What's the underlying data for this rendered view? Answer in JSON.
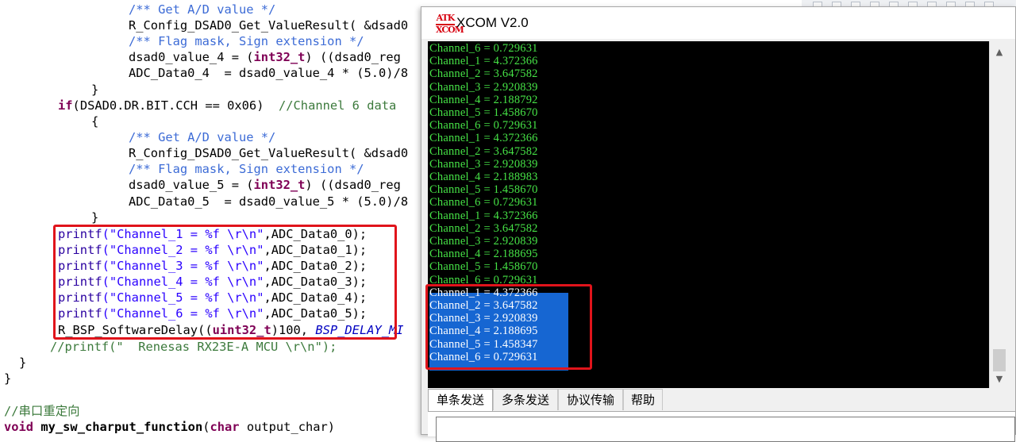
{
  "editor": {
    "lines": [
      [
        [
          "cm",
          "/** Get A/D value */"
        ]
      ],
      [
        [
          "id",
          "R_Config_DSAD0_Get_ValueResult( &dsad0"
        ]
      ],
      [
        [
          "cm",
          "/** Flag mask, Sign extension */"
        ]
      ],
      [
        [
          "id",
          "dsad0_value_4 = ("
        ],
        [
          "kw",
          "int32_t"
        ],
        [
          "id",
          ") ((dsad0_reg"
        ]
      ],
      [
        [
          "id",
          "ADC_Data0_4  = dsad0_value_4 * (5.0)/8"
        ]
      ],
      [
        [
          "id",
          "}"
        ]
      ],
      [
        [
          "kw",
          "if"
        ],
        [
          "id",
          "(DSAD0.DR.BIT.CCH == 0x06)  "
        ],
        [
          "gc",
          "//Channel 6 data"
        ]
      ],
      [
        [
          "id",
          "{"
        ]
      ],
      [
        [
          "cm",
          "/** Get A/D value */"
        ]
      ],
      [
        [
          "id",
          "R_Config_DSAD0_Get_ValueResult( &dsad0"
        ]
      ],
      [
        [
          "cm",
          "/** Flag mask, Sign extension */"
        ]
      ],
      [
        [
          "id",
          "dsad0_value_5 = ("
        ],
        [
          "kw",
          "int32_t"
        ],
        [
          "id",
          ") ((dsad0_reg"
        ]
      ],
      [
        [
          "id",
          "ADC_Data0_5  = dsad0_value_5 * (5.0)/8"
        ]
      ],
      [
        [
          "id",
          "}"
        ]
      ],
      [
        [
          "pp",
          "printf"
        ],
        [
          "st",
          "(\"Channel_1 = %f \\r\\n\""
        ],
        [
          "id",
          ",ADC_Data0_0);"
        ]
      ],
      [
        [
          "pp",
          "printf"
        ],
        [
          "st",
          "(\"Channel_2 = %f \\r\\n\""
        ],
        [
          "id",
          ",ADC_Data0_1);"
        ]
      ],
      [
        [
          "pp",
          "printf"
        ],
        [
          "st",
          "(\"Channel_3 = %f \\r\\n\""
        ],
        [
          "id",
          ",ADC_Data0_2);"
        ]
      ],
      [
        [
          "pp",
          "printf"
        ],
        [
          "st",
          "(\"Channel_4 = %f \\r\\n\""
        ],
        [
          "id",
          ",ADC_Data0_3);"
        ]
      ],
      [
        [
          "pp",
          "printf"
        ],
        [
          "st",
          "(\"Channel_5 = %f \\r\\n\""
        ],
        [
          "id",
          ",ADC_Data0_4);"
        ]
      ],
      [
        [
          "pp",
          "printf"
        ],
        [
          "st",
          "(\"Channel_6 = %f \\r\\n\""
        ],
        [
          "id",
          ",ADC_Data0_5);"
        ]
      ],
      [
        [
          "id",
          "R_BSP_SoftwareDelay(("
        ],
        [
          "kw",
          "uint32_t"
        ],
        [
          "id",
          ")100, "
        ],
        [
          "mac",
          "BSP_DELAY_MI"
        ]
      ],
      [
        [
          "gc",
          "//printf(\"  Renesas RX23E-A MCU \\r\\n\");"
        ]
      ],
      [
        [
          "id",
          "}"
        ]
      ],
      [
        [
          "id",
          "}"
        ]
      ],
      [
        [
          "id",
          ""
        ]
      ],
      [
        [
          "gc",
          "//串口重定向"
        ]
      ],
      [
        [
          "kw",
          "void"
        ],
        [
          "id",
          " "
        ],
        [
          "fn",
          "my_sw_charput_function"
        ],
        [
          "id",
          "("
        ],
        [
          "kw",
          "char"
        ],
        [
          "id",
          " output_char)"
        ]
      ]
    ]
  },
  "xcom": {
    "title": "XCOM V2.0",
    "logo_line1": "ATK",
    "logo_line2": "XCOM",
    "terminal_lines": [
      "Channel_6 = 0.729631",
      "Channel_1 = 4.372366",
      "Channel_2 = 3.647582",
      "Channel_3 = 2.920839",
      "Channel_4 = 2.188792",
      "Channel_5 = 1.458670",
      "Channel_6 = 0.729631",
      "Channel_1 = 4.372366",
      "Channel_2 = 3.647582",
      "Channel_3 = 2.920839",
      "Channel_4 = 2.188983",
      "Channel_5 = 1.458670",
      "Channel_6 = 0.729631",
      "Channel_1 = 4.372366",
      "Channel_2 = 3.647582",
      "Channel_3 = 2.920839",
      "Channel_4 = 2.188695",
      "Channel_5 = 1.458670",
      "Channel_6 = 0.729631",
      "Channel_1 = 4.372366",
      "Channel_2 = 3.647582",
      "Channel_3 = 2.920839",
      "Channel_4 = 2.188695",
      "Channel_5 = 1.458347",
      "Channel_6 = 0.729631"
    ],
    "selected_from_line": 19,
    "tabs": [
      "单条发送",
      "多条发送",
      "协议传输",
      "帮助"
    ],
    "active_tab": 0,
    "colors": {
      "terminal_bg": "#000000",
      "terminal_text": "#46e246",
      "selection": "#1666d2",
      "highlight_box": "#e0141b"
    }
  }
}
